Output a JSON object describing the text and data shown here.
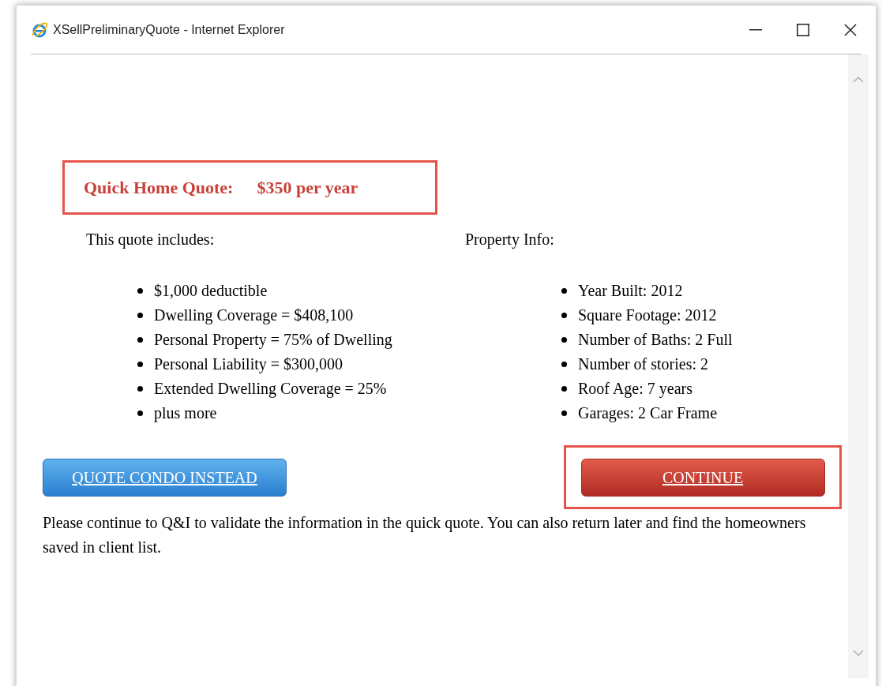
{
  "window": {
    "title": "XSellPreliminaryQuote - Internet Explorer"
  },
  "quote": {
    "label": "Quick Home Quote:",
    "price": "$350 per year",
    "highlighted": true
  },
  "includes": {
    "heading": "This quote includes:",
    "items": [
      "$1,000 deductible",
      "Dwelling Coverage = $408,100",
      "Personal Property = 75% of Dwelling",
      "Personal Liability = $300,000",
      "Extended Dwelling Coverage = 25%",
      "plus more"
    ]
  },
  "property": {
    "heading": "Property Info:",
    "items": [
      "Year Built: 2012",
      "Square Footage: 2012",
      "Number of Baths: 2 Full",
      "Number of stories: 2",
      "Roof Age: 7 years",
      "Garages: 2 Car Frame"
    ]
  },
  "buttons": [
    {
      "label": "QUOTE CONDO INSTEAD",
      "kind": "secondary",
      "highlighted": false
    },
    {
      "label": "CONTINUE",
      "kind": "primary",
      "highlighted": true
    }
  ],
  "note": "Please continue to Q&I to validate the information in the quick quote. You can also return later and find the homeowners saved in client list."
}
